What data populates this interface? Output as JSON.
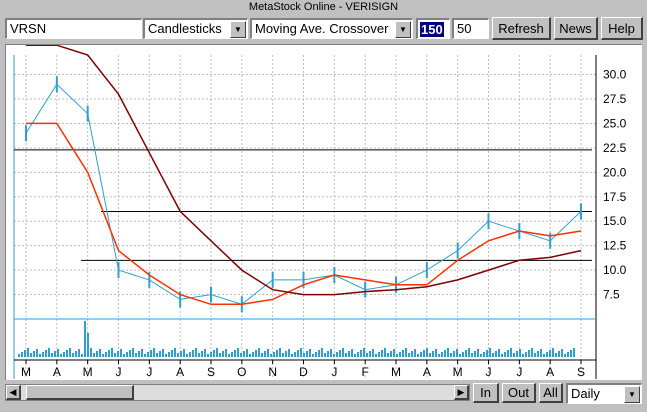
{
  "window": {
    "title": "MetaStock Online - VERISIGN"
  },
  "toolbar": {
    "symbol": "VRSN",
    "chart_style": "Candlesticks",
    "indicator": "Moving Ave. Crossover",
    "period1": "150",
    "period2": "50",
    "refresh_label": "Refresh",
    "news_label": "News",
    "help_label": "Help"
  },
  "bottom": {
    "in_label": "In",
    "out_label": "Out",
    "all_label": "All",
    "interval": "Daily"
  },
  "colors": {
    "price": "#2f9fcf",
    "ma_fast": "#ff3000",
    "ma_slow": "#800000",
    "hline": "#000000"
  },
  "chart_data": {
    "type": "line",
    "title": "",
    "x": [
      "M",
      "A",
      "M",
      "J",
      "J",
      "A",
      "S",
      "O",
      "N",
      "D",
      "J",
      "F",
      "M",
      "A",
      "M",
      "J",
      "J",
      "A",
      "S"
    ],
    "y_ticks": [
      "7.5",
      "10.0",
      "12.5",
      "15.0",
      "17.5",
      "20.0",
      "22.5",
      "25.0",
      "27.5",
      "30.0"
    ],
    "ylim": [
      5,
      32
    ],
    "grid": true,
    "horizontal_lines": [
      22.3,
      16.0,
      11.0
    ],
    "series": [
      {
        "values": [
          24,
          29,
          26,
          10,
          9,
          7,
          7.5,
          6.5,
          9,
          9,
          9.5,
          8,
          8.5,
          10,
          12,
          15,
          14,
          13,
          16
        ]
      },
      {
        "values": [
          25,
          25,
          20,
          12,
          9.5,
          7.5,
          6.5,
          6.5,
          7,
          8.5,
          9.5,
          9,
          8.5,
          8.5,
          11,
          13,
          14,
          13.5,
          14
        ]
      },
      {
        "values": [
          33,
          33,
          32,
          28,
          22,
          16,
          13,
          10,
          8,
          7.5,
          7.5,
          7.8,
          8,
          8.3,
          9,
          10,
          11,
          11.3,
          12
        ]
      }
    ]
  }
}
